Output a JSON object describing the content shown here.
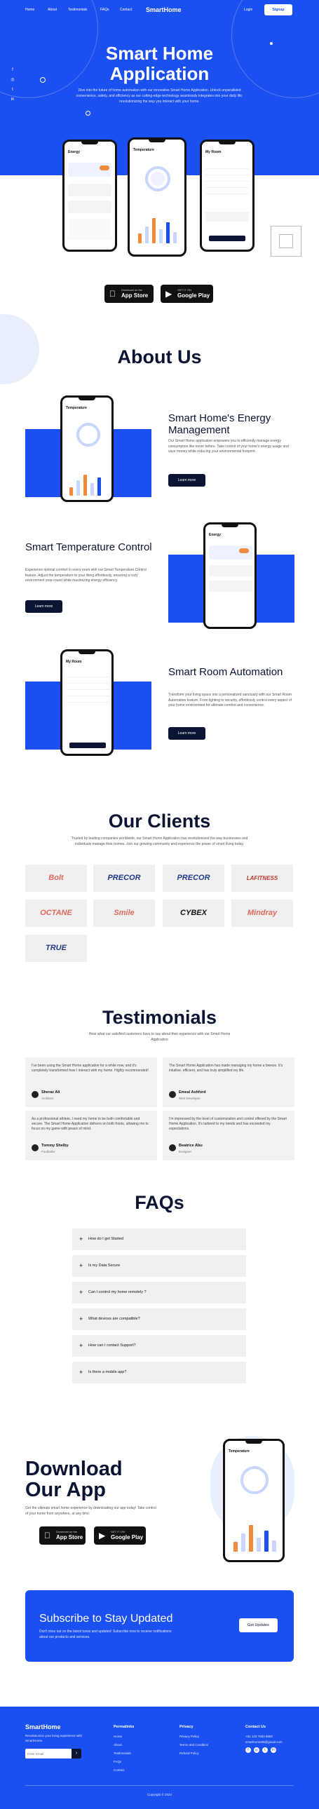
{
  "nav": {
    "links": [
      "Home",
      "About",
      "Testimonials",
      "FAQs",
      "Contact"
    ],
    "logo": "SmartHome",
    "login": "Login",
    "signup": "Signup"
  },
  "hero": {
    "title": "Smart Home Application",
    "text": "Dive into the future of home automation with our innovative Smart Home Application. Unlock unparalleled convenience, safety, and efficiency as our cutting-edge technology seamlessly integrates into your daily life, revolutionizing the way you interact with your home."
  },
  "phones": {
    "energy_title": "Energy",
    "temperature_title": "Temperature",
    "room_title": "My Room"
  },
  "stores": {
    "apple_small": "Download on the",
    "apple_big": "App Store",
    "google_small": "GET IT ON",
    "google_big": "Google Play"
  },
  "about": {
    "title": "About Us",
    "features": [
      {
        "title": "Smart Home's Energy Management",
        "text": "Our Smart Home application empowers you to efficiently manage energy consumption like never before. Take control of your home's energy usage and save money while reducing your environmental footprint.",
        "button": "Learn more"
      },
      {
        "title": "Smart Temperature Control",
        "text": "Experience optimal comfort in every room with our Smart Temperature Control feature. Adjust the temperature to your liking effortlessly, ensuring a cozy environment year-round while maximizing energy efficiency.",
        "button": "Learn more"
      },
      {
        "title": "Smart Room Automation",
        "text": "Transform your living space into a personalized sanctuary with our Smart Room Automation feature. From lighting to security, effortlessly control every aspect of your home environment for ultimate comfort and convenience.",
        "button": "Learn more"
      }
    ]
  },
  "clients": {
    "title": "Our Clients",
    "text": "Trusted by leading companies worldwide, our Smart Home Application has revolutionized the way businesses and individuals manage their homes. Join our growing community and experience the power of smart living today.",
    "logos": [
      "Bolt",
      "PRECOR",
      "PRECOR",
      "LAFITNESS",
      "OCTANE",
      "Smile",
      "CYBEX",
      "Mindray",
      "TRUE"
    ],
    "logo_colors": [
      "#e0685a",
      "#1e3a8a",
      "#1e3a8a",
      "#c0392b",
      "#e0685a",
      "#e0685a",
      "#111111",
      "#e0685a",
      "#1e3a8a"
    ]
  },
  "testimonials": {
    "title": "Testimonials",
    "subtitle": "Hear what our satisfied customers have to say about their experience with our Smart Home Application",
    "items": [
      {
        "quote": "I've been using the Smart Home application for a while now, and it's completely transformed how I interact with my home. Highly recommended!",
        "name": "Sheraz Ali",
        "role": "Architect"
      },
      {
        "quote": "The Smart Home Application has made managing my home a breeze. It's intuitive, efficient, and has truly simplified my life.",
        "name": "Emeal Ashford",
        "role": "Web Developer"
      },
      {
        "quote": "As a professional athlete, I need my home to be both comfortable and secure. The Smart Home Application delivers on both fronts, allowing me to focus on my game with peace of mind.",
        "name": "Tommy Shelby",
        "role": "Footballer"
      },
      {
        "quote": "I'm impressed by the level of customization and control offered by the Smart Home Application. It's tailored to my needs and has exceeded my expectations.",
        "name": "Beatrice Abu",
        "role": "Designer"
      }
    ]
  },
  "faqs": {
    "title": "FAQs",
    "items": [
      "How do I get Started",
      "Is my Data Secure",
      "Can I control my home remotely ?",
      "What devices are compatible?",
      "How can I contact Support?",
      "Is there a mobile app?"
    ]
  },
  "download": {
    "title": "Download Our App",
    "text": "Get the ultimate smart home experience by downloading our app today! Take control of your home from anywhere, at any time."
  },
  "subscribe": {
    "title": "Subscribe to Stay Updated",
    "text": "Don't miss out on the latest news and updates! Subscribe now to receive notifications about our products and services.",
    "button": "Get Updates"
  },
  "footer": {
    "logo": "SmartHome",
    "tagline": "Revolutionize your living experience with SmartHome.",
    "email_placeholder": "Enter Email",
    "col1_title": "Permalinks",
    "col1_links": [
      "Home",
      "About",
      "Testimonials",
      "FAQs",
      "Contact"
    ],
    "col2_title": "Privacy",
    "col2_links": [
      "Privacy Policy",
      "Terms and Condition",
      "Refund Policy"
    ],
    "col3_title": "Contact Us",
    "phone": "+91 123 7583 8950",
    "email": "smarthome99@gmail.com",
    "social_icons": [
      "facebook-icon",
      "instagram-icon",
      "twitter-icon",
      "linkedin-icon"
    ],
    "copyright": "Copyright © 2024"
  },
  "colors": {
    "primary": "#1a4ff0",
    "dark": "#0b1533"
  }
}
